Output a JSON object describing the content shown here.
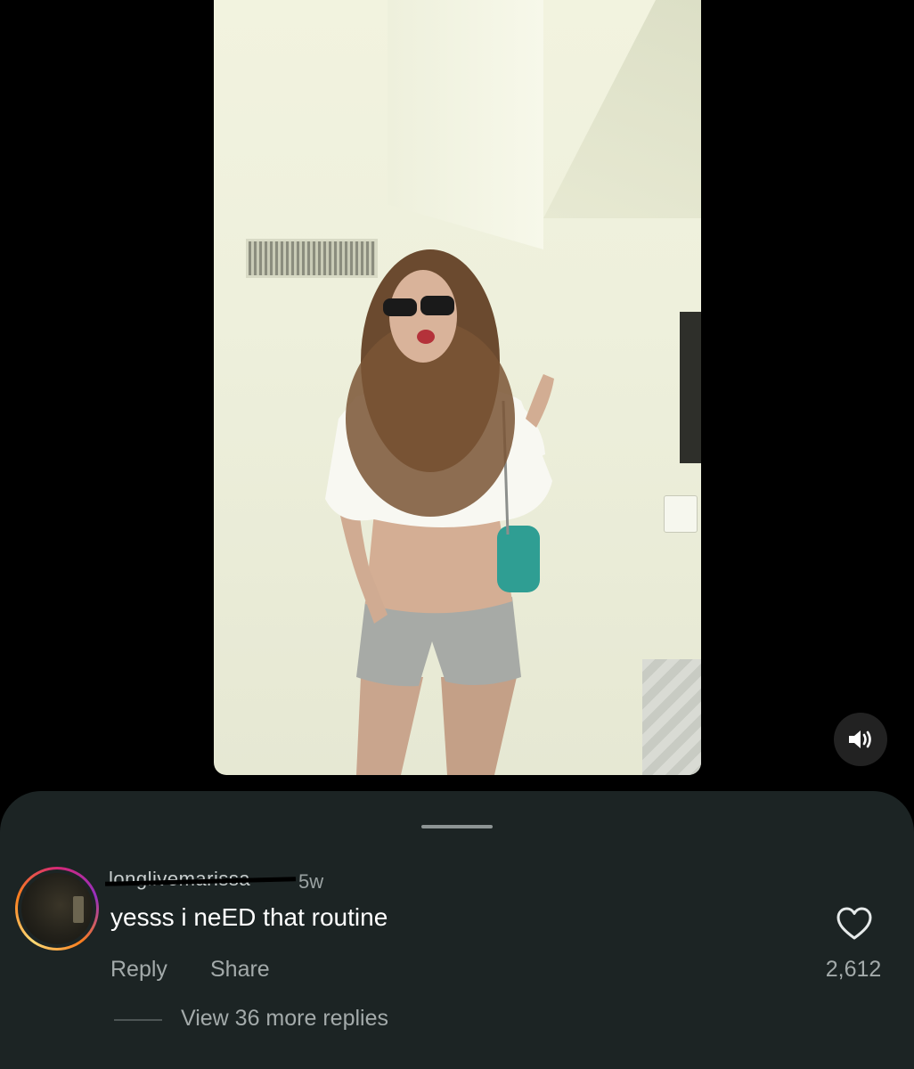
{
  "video": {
    "volume_icon": "speaker-on-icon"
  },
  "comments": {
    "items": [
      {
        "username": "longlivemarissa",
        "time": "5w",
        "text": "yesss i neED that routine",
        "reply_label": "Reply",
        "share_label": "Share",
        "like_icon": "heart-outline-icon",
        "like_count": "2,612",
        "view_replies_label": "View 36 more replies"
      }
    ]
  },
  "colors": {
    "sheet_background": "#1c2424",
    "primary_text": "#ffffff",
    "secondary_text": "#a3aaaa",
    "story_ring": [
      "#d62976",
      "#962fbf",
      "#fa7e1e",
      "#feda75"
    ]
  }
}
